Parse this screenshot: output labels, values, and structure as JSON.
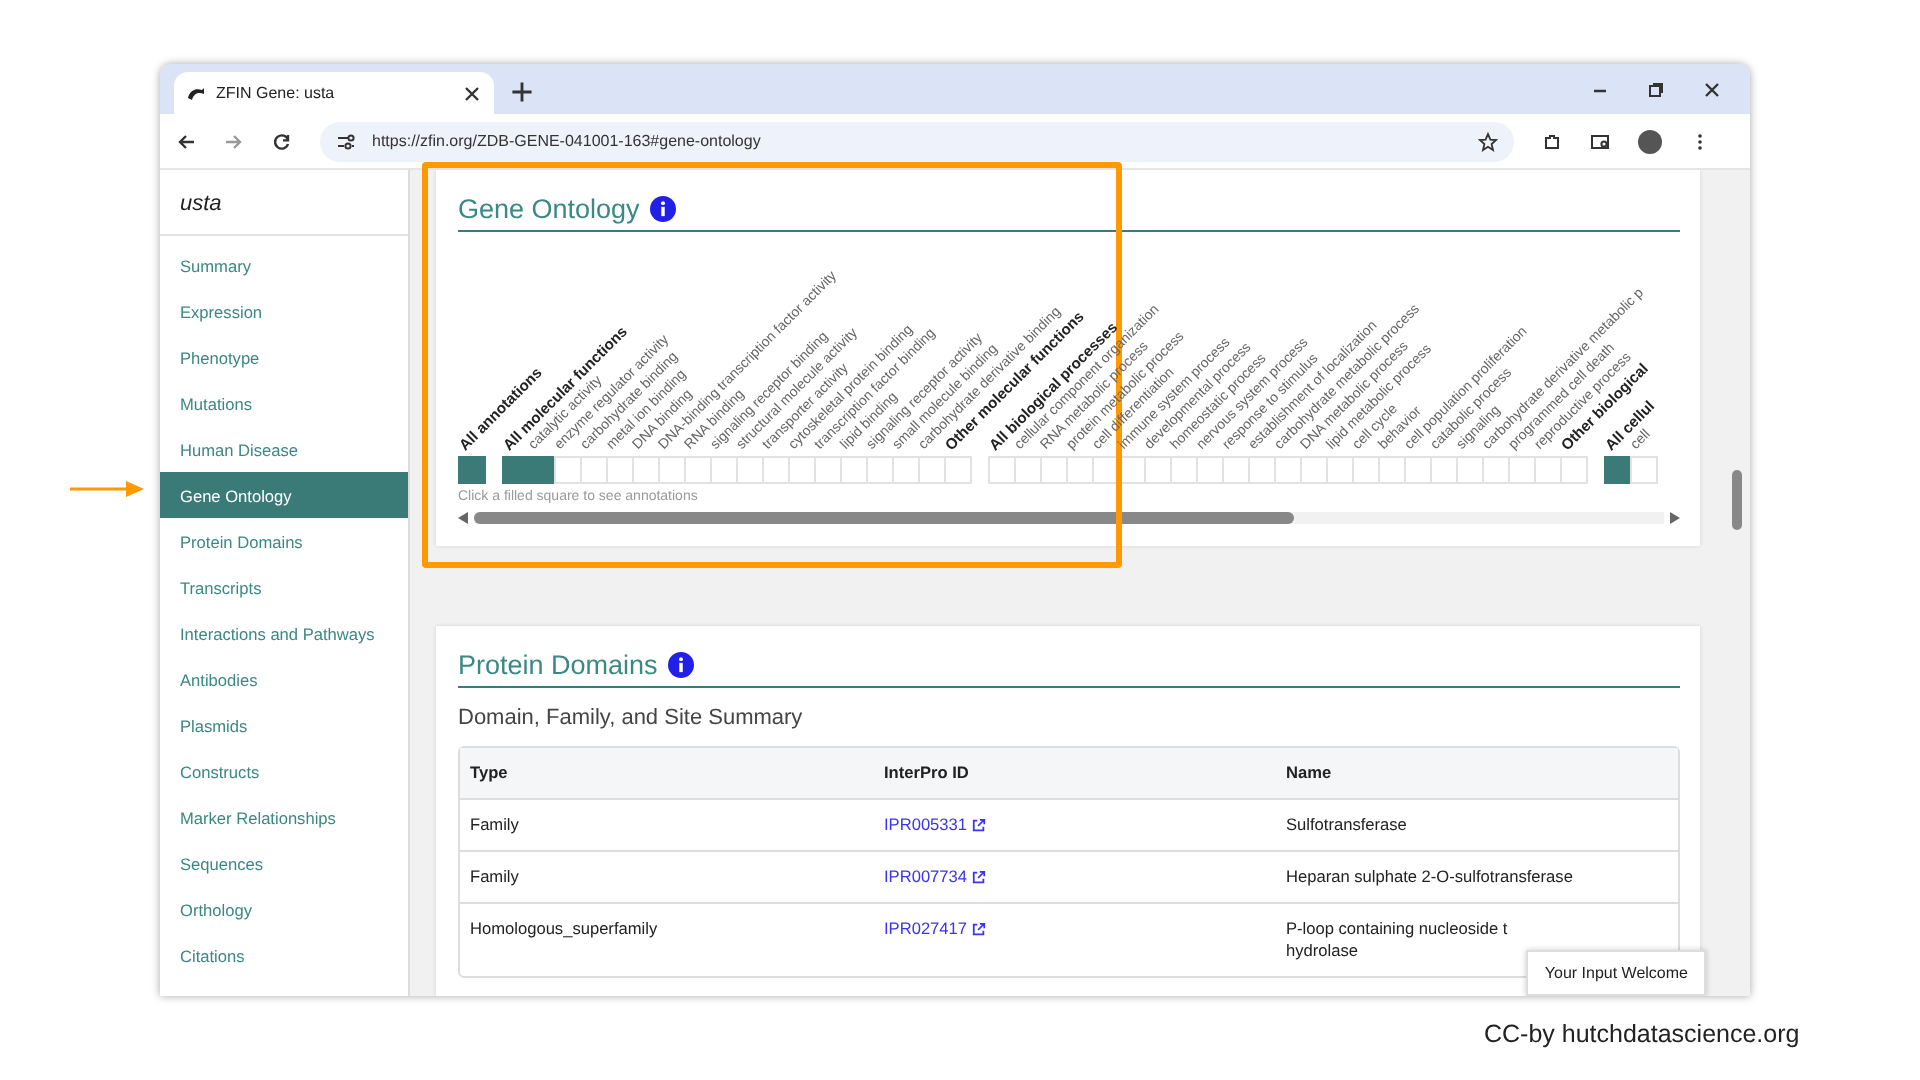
{
  "browser": {
    "tab_title": "ZFIN Gene: usta",
    "url": "https://zfin.org/ZDB-GENE-041001-163#gene-ontology"
  },
  "sidebar": {
    "title": "usta",
    "items": [
      {
        "label": "Summary",
        "selected": false
      },
      {
        "label": "Expression",
        "selected": false
      },
      {
        "label": "Phenotype",
        "selected": false
      },
      {
        "label": "Mutations",
        "selected": false
      },
      {
        "label": "Human Disease",
        "selected": false
      },
      {
        "label": "Gene Ontology",
        "selected": true
      },
      {
        "label": "Protein Domains",
        "selected": false
      },
      {
        "label": "Transcripts",
        "selected": false
      },
      {
        "label": "Interactions and Pathways",
        "selected": false
      },
      {
        "label": "Antibodies",
        "selected": false
      },
      {
        "label": "Plasmids",
        "selected": false
      },
      {
        "label": "Constructs",
        "selected": false
      },
      {
        "label": "Marker Relationships",
        "selected": false
      },
      {
        "label": "Sequences",
        "selected": false
      },
      {
        "label": "Orthology",
        "selected": false
      },
      {
        "label": "Citations",
        "selected": false
      }
    ]
  },
  "gene_ontology": {
    "title": "Gene Ontology",
    "groups": [
      {
        "terms": [
          {
            "label": "All annotations",
            "kind": "summary",
            "filled": true
          }
        ]
      },
      {
        "terms": [
          {
            "label": "All molecular functions",
            "kind": "summary",
            "filled": true
          },
          {
            "label": "catalytic activity",
            "kind": "term",
            "filled": true
          },
          {
            "label": "enzyme regulator activity",
            "kind": "term",
            "filled": false
          },
          {
            "label": "carbohydrate binding",
            "kind": "term",
            "filled": false
          },
          {
            "label": "metal ion binding",
            "kind": "term",
            "filled": false
          },
          {
            "label": "DNA binding",
            "kind": "term",
            "filled": false
          },
          {
            "label": "DNA-binding transcription factor activity",
            "kind": "term",
            "filled": false
          },
          {
            "label": "RNA binding",
            "kind": "term",
            "filled": false
          },
          {
            "label": "signaling receptor binding",
            "kind": "term",
            "filled": false
          },
          {
            "label": "structural molecule activity",
            "kind": "term",
            "filled": false
          },
          {
            "label": "transporter activity",
            "kind": "term",
            "filled": false
          },
          {
            "label": "cytoskeletal protein binding",
            "kind": "term",
            "filled": false
          },
          {
            "label": "transcription factor binding",
            "kind": "term",
            "filled": false
          },
          {
            "label": "lipid binding",
            "kind": "term",
            "filled": false
          },
          {
            "label": "signaling receptor activity",
            "kind": "term",
            "filled": false
          },
          {
            "label": "small molecule binding",
            "kind": "term",
            "filled": false
          },
          {
            "label": "carbohydrate derivative binding",
            "kind": "term",
            "filled": false
          },
          {
            "label": "Other molecular functions",
            "kind": "summary",
            "filled": false
          }
        ]
      },
      {
        "terms": [
          {
            "label": "All biological processes",
            "kind": "summary",
            "filled": false
          },
          {
            "label": "cellular component organization",
            "kind": "term",
            "filled": false
          },
          {
            "label": "RNA metabolic process",
            "kind": "term",
            "filled": false
          },
          {
            "label": "protein metabolic process",
            "kind": "term",
            "filled": false
          },
          {
            "label": "cell differentiation",
            "kind": "term",
            "filled": false
          },
          {
            "label": "immune system process",
            "kind": "term",
            "filled": false
          },
          {
            "label": "developmental process",
            "kind": "term",
            "filled": false
          },
          {
            "label": "homeostatic process",
            "kind": "term",
            "filled": false
          },
          {
            "label": "nervous system process",
            "kind": "term",
            "filled": false
          },
          {
            "label": "response to stimulus",
            "kind": "term",
            "filled": false
          },
          {
            "label": "establishment of localization",
            "kind": "term",
            "filled": false
          },
          {
            "label": "carbohydrate metabolic process",
            "kind": "term",
            "filled": false
          },
          {
            "label": "DNA metabolic process",
            "kind": "term",
            "filled": false
          },
          {
            "label": "lipid metabolic process",
            "kind": "term",
            "filled": false
          },
          {
            "label": "cell cycle",
            "kind": "term",
            "filled": false
          },
          {
            "label": "behavior",
            "kind": "term",
            "filled": false
          },
          {
            "label": "cell population proliferation",
            "kind": "term",
            "filled": false
          },
          {
            "label": "catabolic process",
            "kind": "term",
            "filled": false
          },
          {
            "label": "signaling",
            "kind": "term",
            "filled": false
          },
          {
            "label": "carbohydrate derivative metabolic p",
            "kind": "term",
            "filled": false
          },
          {
            "label": "programmed cell death",
            "kind": "term",
            "filled": false
          },
          {
            "label": "reproductive process",
            "kind": "term",
            "filled": false
          },
          {
            "label": "Other biological",
            "kind": "summary",
            "filled": false
          }
        ]
      },
      {
        "terms": [
          {
            "label": "All cellul",
            "kind": "summary",
            "filled": true
          },
          {
            "label": "cell",
            "kind": "term",
            "filled": false
          }
        ]
      }
    ],
    "hint": "Click a filled square to see annotations"
  },
  "protein_domains": {
    "title": "Protein Domains",
    "subtitle": "Domain, Family, and Site Summary",
    "columns": [
      "Type",
      "InterPro ID",
      "Name"
    ],
    "rows": [
      {
        "type": "Family",
        "interpro_id": "IPR005331",
        "name": [
          "Sulfotransferase"
        ]
      },
      {
        "type": "Family",
        "interpro_id": "IPR007734",
        "name": [
          "Heparan sulphate 2-O-sulfotransferase"
        ]
      },
      {
        "type": "Homologous_superfamily",
        "interpro_id": "IPR027417",
        "name": [
          "P-loop containing nucleoside t",
          "hydrolase"
        ]
      }
    ]
  },
  "feedback_button": "Your Input Welcome",
  "credit": "CC-by hutchdatascience.org"
}
